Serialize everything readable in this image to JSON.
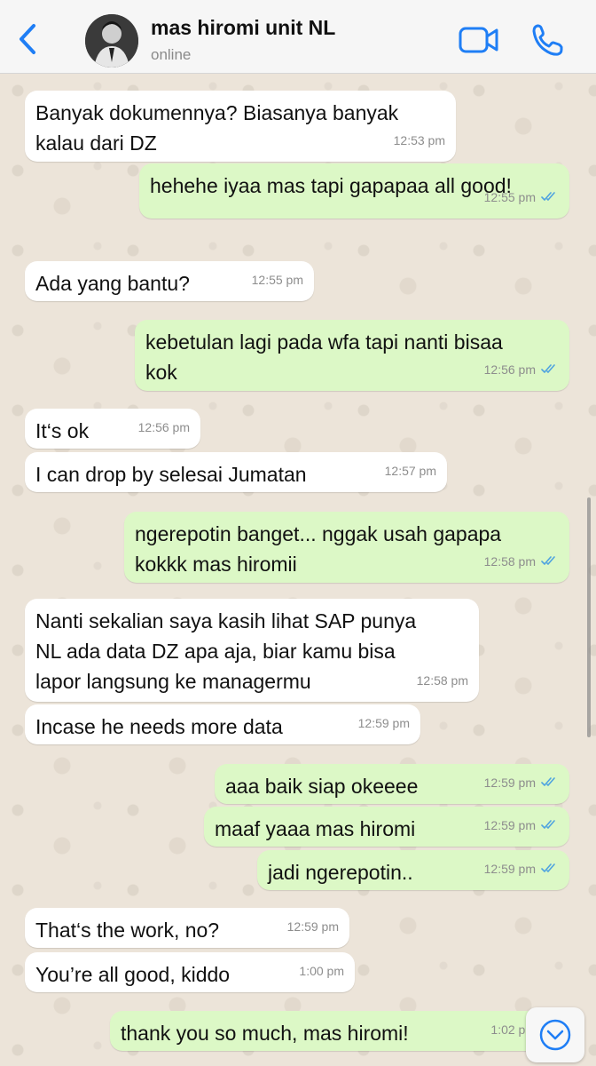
{
  "header": {
    "contact_name": "mas hiromi unit NL",
    "status": "online",
    "accent_color": "#1f7ef5"
  },
  "messages": [
    {
      "direction": "incoming",
      "lines": [
        "Banyak dokumennya? Biasanya banyak",
        "kalau dari DZ"
      ],
      "time": "12:53 pm"
    },
    {
      "direction": "outgoing",
      "lines": [
        "hehehe iyaa mas tapi gapapaa all good!"
      ],
      "time": "12:55 pm",
      "read": true
    },
    {
      "direction": "incoming",
      "lines": [
        "Ada yang bantu?"
      ],
      "time": "12:55 pm"
    },
    {
      "direction": "outgoing",
      "lines": [
        "kebetulan lagi pada wfa tapi nanti bisaa",
        "kok"
      ],
      "time": "12:56 pm",
      "read": true
    },
    {
      "direction": "incoming",
      "lines": [
        "It‘s ok"
      ],
      "time": "12:56 pm"
    },
    {
      "direction": "incoming",
      "lines": [
        "I can drop by selesai Jumatan"
      ],
      "time": "12:57 pm"
    },
    {
      "direction": "outgoing",
      "lines": [
        "ngerepotin banget... nggak usah gapapa",
        "kokkk mas hiromii"
      ],
      "time": "12:58 pm",
      "read": true
    },
    {
      "direction": "incoming",
      "lines": [
        "Nanti sekalian saya kasih lihat SAP punya",
        "NL ada data DZ apa aja, biar kamu bisa",
        "lapor langsung ke managermu"
      ],
      "time": "12:58 pm"
    },
    {
      "direction": "incoming",
      "lines": [
        "Incase he needs more data"
      ],
      "time": "12:59 pm"
    },
    {
      "direction": "outgoing",
      "lines": [
        "aaa baik siap okeeee"
      ],
      "time": "12:59 pm",
      "read": true
    },
    {
      "direction": "outgoing",
      "lines": [
        "maaf yaaa mas hiromi"
      ],
      "time": "12:59 pm",
      "read": true
    },
    {
      "direction": "outgoing",
      "lines": [
        "jadi ngerepotin.."
      ],
      "time": "12:59 pm",
      "read": true
    },
    {
      "direction": "incoming",
      "lines": [
        "That‘s the work, no?"
      ],
      "time": "12:59 pm"
    },
    {
      "direction": "incoming",
      "lines": [
        "You’re all good, kiddo"
      ],
      "time": "1:00 pm"
    },
    {
      "direction": "outgoing",
      "lines": [
        "thank you so much, mas hiromi!"
      ],
      "time": "1:02 pm",
      "read": true
    }
  ],
  "icons": {
    "back": "chevron-left-icon",
    "video": "video-camera-icon",
    "call": "phone-icon",
    "read_receipt": "double-check-icon",
    "scroll_down": "chevron-down-circle-icon"
  },
  "colors": {
    "incoming_bubble": "#ffffff",
    "outgoing_bubble": "#dcf8c6",
    "read_tick": "#4fa3e0",
    "chat_background": "#ece4d9"
  }
}
